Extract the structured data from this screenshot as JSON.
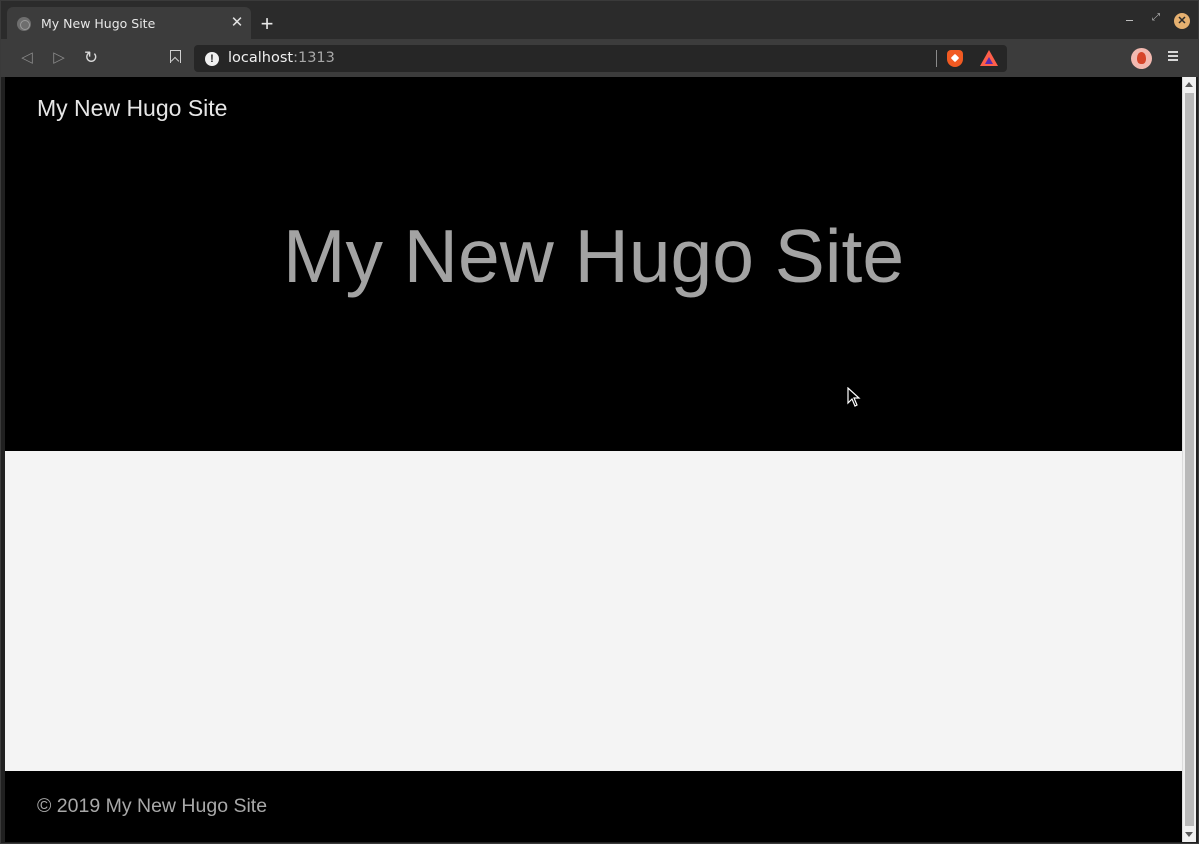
{
  "browser": {
    "tab": {
      "title": "My New Hugo Site",
      "favicon": "globe-icon",
      "close_glyph": "✕"
    },
    "new_tab_glyph": "+",
    "window_controls": {
      "minimize": "minimize-icon",
      "maximize_glyph": "⤢",
      "close_glyph": "✕"
    },
    "toolbar": {
      "back_glyph": "◁",
      "forward_glyph": "▷",
      "reload_glyph": "↻",
      "bookmark_icon": "bookmark-icon"
    },
    "address_bar": {
      "info_glyph": "!",
      "host": "localhost",
      "port": ":1313"
    },
    "extensions": [
      "brave-shields-icon",
      "brave-rewards-icon"
    ],
    "profile_icon": "avatar-icon",
    "menu_icon": "hamburger-menu-icon"
  },
  "page": {
    "header": {
      "site_title": "My New Hugo Site"
    },
    "hero": {
      "title": "My New Hugo Site"
    },
    "footer": {
      "text": "© 2019 My New Hugo Site"
    }
  },
  "colors": {
    "hero_background": "#000000",
    "main_background": "#f4f4f4",
    "hero_title": "#a3a3a3",
    "site_title": "#e6e6e6",
    "footer_text": "#a8a8a8"
  }
}
